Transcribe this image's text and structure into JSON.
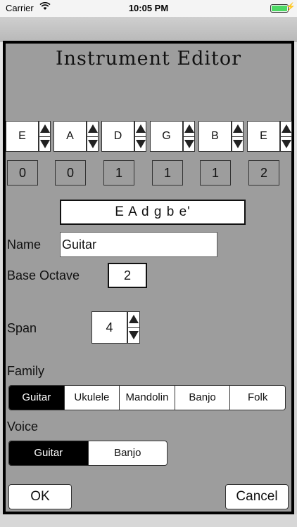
{
  "status_bar": {
    "carrier": "Carrier",
    "time": "10:05 PM"
  },
  "title": "Instrument Editor",
  "strings": [
    {
      "note": "E",
      "octave": "0"
    },
    {
      "note": "A",
      "octave": "0"
    },
    {
      "note": "D",
      "octave": "1"
    },
    {
      "note": "G",
      "octave": "1"
    },
    {
      "note": "B",
      "octave": "1"
    },
    {
      "note": "E",
      "octave": "2"
    }
  ],
  "tuning_display": "E A d g b e'",
  "name": {
    "label": "Name",
    "value": "Guitar"
  },
  "base_octave": {
    "label": "Base Octave",
    "value": "2"
  },
  "span": {
    "label": "Span",
    "value": "4"
  },
  "family": {
    "label": "Family",
    "options": [
      "Guitar",
      "Ukulele",
      "Mandolin",
      "Banjo",
      "Folk"
    ],
    "selected": "Guitar"
  },
  "voice": {
    "label": "Voice",
    "options": [
      "Guitar",
      "Banjo"
    ],
    "selected": "Guitar"
  },
  "buttons": {
    "ok": "OK",
    "cancel": "Cancel"
  },
  "colors": {
    "panel": "#9d9d9d",
    "selected_segment": "#000000",
    "battery": "#4cd964"
  }
}
